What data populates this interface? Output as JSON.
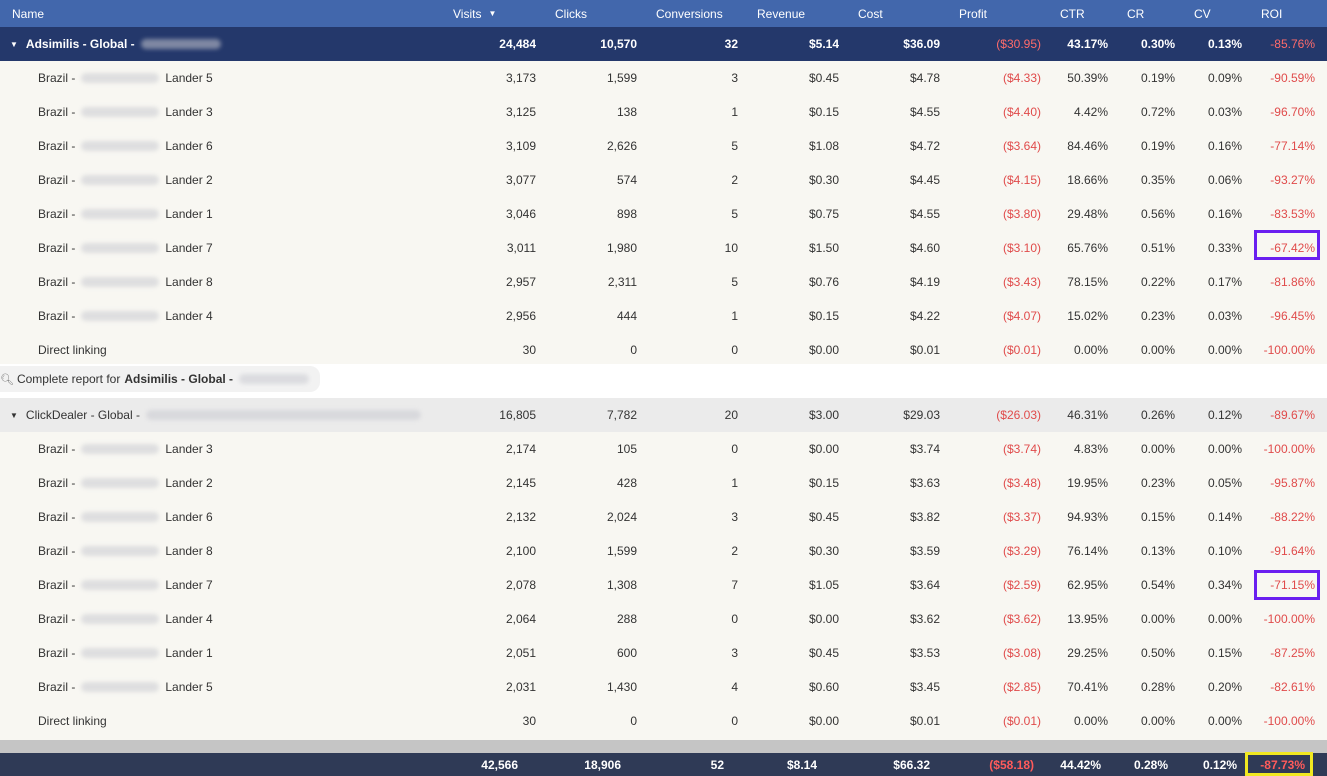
{
  "header": {
    "name": "Name",
    "visits": "Visits",
    "clicks": "Clicks",
    "conversions": "Conversions",
    "revenue": "Revenue",
    "cost": "Cost",
    "profit": "Profit",
    "ctr": "CTR",
    "cr": "CR",
    "cv": "CV",
    "roi": "ROI"
  },
  "groups": [
    {
      "name": "Adsimilis - Global -",
      "totals": {
        "visits": "24,484",
        "clicks": "10,570",
        "conversions": "32",
        "revenue": "$5.14",
        "cost": "$36.09",
        "profit": "($30.95)",
        "ctr": "43.17%",
        "cr": "0.30%",
        "cv": "0.13%",
        "roi": "-85.76%"
      },
      "rows": [
        {
          "prefix": "Brazil -",
          "lander": "Lander 5",
          "visits": "3,173",
          "clicks": "1,599",
          "conversions": "3",
          "revenue": "$0.45",
          "cost": "$4.78",
          "profit": "($4.33)",
          "ctr": "50.39%",
          "cr": "0.19%",
          "cv": "0.09%",
          "roi": "-90.59%"
        },
        {
          "prefix": "Brazil -",
          "lander": "Lander 3",
          "visits": "3,125",
          "clicks": "138",
          "conversions": "1",
          "revenue": "$0.15",
          "cost": "$4.55",
          "profit": "($4.40)",
          "ctr": "4.42%",
          "cr": "0.72%",
          "cv": "0.03%",
          "roi": "-96.70%"
        },
        {
          "prefix": "Brazil -",
          "lander": "Lander 6",
          "visits": "3,109",
          "clicks": "2,626",
          "conversions": "5",
          "revenue": "$1.08",
          "cost": "$4.72",
          "profit": "($3.64)",
          "ctr": "84.46%",
          "cr": "0.19%",
          "cv": "0.16%",
          "roi": "-77.14%"
        },
        {
          "prefix": "Brazil -",
          "lander": "Lander 2",
          "visits": "3,077",
          "clicks": "574",
          "conversions": "2",
          "revenue": "$0.30",
          "cost": "$4.45",
          "profit": "($4.15)",
          "ctr": "18.66%",
          "cr": "0.35%",
          "cv": "0.06%",
          "roi": "-93.27%"
        },
        {
          "prefix": "Brazil -",
          "lander": "Lander 1",
          "visits": "3,046",
          "clicks": "898",
          "conversions": "5",
          "revenue": "$0.75",
          "cost": "$4.55",
          "profit": "($3.80)",
          "ctr": "29.48%",
          "cr": "0.56%",
          "cv": "0.16%",
          "roi": "-83.53%"
        },
        {
          "prefix": "Brazil -",
          "lander": "Lander 7",
          "visits": "3,011",
          "clicks": "1,980",
          "conversions": "10",
          "revenue": "$1.50",
          "cost": "$4.60",
          "profit": "($3.10)",
          "ctr": "65.76%",
          "cr": "0.51%",
          "cv": "0.33%",
          "roi": "-67.42%"
        },
        {
          "prefix": "Brazil -",
          "lander": "Lander 8",
          "visits": "2,957",
          "clicks": "2,311",
          "conversions": "5",
          "revenue": "$0.76",
          "cost": "$4.19",
          "profit": "($3.43)",
          "ctr": "78.15%",
          "cr": "0.22%",
          "cv": "0.17%",
          "roi": "-81.86%"
        },
        {
          "prefix": "Brazil -",
          "lander": "Lander 4",
          "visits": "2,956",
          "clicks": "444",
          "conversions": "1",
          "revenue": "$0.15",
          "cost": "$4.22",
          "profit": "($4.07)",
          "ctr": "15.02%",
          "cr": "0.23%",
          "cv": "0.03%",
          "roi": "-96.45%"
        },
        {
          "prefix": "Direct linking",
          "lander": "",
          "visits": "30",
          "clicks": "0",
          "conversions": "0",
          "revenue": "$0.00",
          "cost": "$0.01",
          "profit": "($0.01)",
          "ctr": "0.00%",
          "cr": "0.00%",
          "cv": "0.00%",
          "roi": "-100.00%"
        }
      ],
      "complete_report": {
        "prefix": "Complete report for",
        "bold": "Adsimilis - Global -"
      }
    },
    {
      "name": "ClickDealer - Global -",
      "totals": {
        "visits": "16,805",
        "clicks": "7,782",
        "conversions": "20",
        "revenue": "$3.00",
        "cost": "$29.03",
        "profit": "($26.03)",
        "ctr": "46.31%",
        "cr": "0.26%",
        "cv": "0.12%",
        "roi": "-89.67%"
      },
      "rows": [
        {
          "prefix": "Brazil -",
          "lander": "Lander 3",
          "visits": "2,174",
          "clicks": "105",
          "conversions": "0",
          "revenue": "$0.00",
          "cost": "$3.74",
          "profit": "($3.74)",
          "ctr": "4.83%",
          "cr": "0.00%",
          "cv": "0.00%",
          "roi": "-100.00%"
        },
        {
          "prefix": "Brazil -",
          "lander": "Lander 2",
          "visits": "2,145",
          "clicks": "428",
          "conversions": "1",
          "revenue": "$0.15",
          "cost": "$3.63",
          "profit": "($3.48)",
          "ctr": "19.95%",
          "cr": "0.23%",
          "cv": "0.05%",
          "roi": "-95.87%"
        },
        {
          "prefix": "Brazil -",
          "lander": "Lander 6",
          "visits": "2,132",
          "clicks": "2,024",
          "conversions": "3",
          "revenue": "$0.45",
          "cost": "$3.82",
          "profit": "($3.37)",
          "ctr": "94.93%",
          "cr": "0.15%",
          "cv": "0.14%",
          "roi": "-88.22%"
        },
        {
          "prefix": "Brazil -",
          "lander": "Lander 8",
          "visits": "2,100",
          "clicks": "1,599",
          "conversions": "2",
          "revenue": "$0.30",
          "cost": "$3.59",
          "profit": "($3.29)",
          "ctr": "76.14%",
          "cr": "0.13%",
          "cv": "0.10%",
          "roi": "-91.64%"
        },
        {
          "prefix": "Brazil -",
          "lander": "Lander 7",
          "visits": "2,078",
          "clicks": "1,308",
          "conversions": "7",
          "revenue": "$1.05",
          "cost": "$3.64",
          "profit": "($2.59)",
          "ctr": "62.95%",
          "cr": "0.54%",
          "cv": "0.34%",
          "roi": "-71.15%"
        },
        {
          "prefix": "Brazil -",
          "lander": "Lander 4",
          "visits": "2,064",
          "clicks": "288",
          "conversions": "0",
          "revenue": "$0.00",
          "cost": "$3.62",
          "profit": "($3.62)",
          "ctr": "13.95%",
          "cr": "0.00%",
          "cv": "0.00%",
          "roi": "-100.00%"
        },
        {
          "prefix": "Brazil -",
          "lander": "Lander 1",
          "visits": "2,051",
          "clicks": "600",
          "conversions": "3",
          "revenue": "$0.45",
          "cost": "$3.53",
          "profit": "($3.08)",
          "ctr": "29.25%",
          "cr": "0.50%",
          "cv": "0.15%",
          "roi": "-87.25%"
        },
        {
          "prefix": "Brazil -",
          "lander": "Lander 5",
          "visits": "2,031",
          "clicks": "1,430",
          "conversions": "4",
          "revenue": "$0.60",
          "cost": "$3.45",
          "profit": "($2.85)",
          "ctr": "70.41%",
          "cr": "0.28%",
          "cv": "0.20%",
          "roi": "-82.61%"
        },
        {
          "prefix": "Direct linking",
          "lander": "",
          "visits": "30",
          "clicks": "0",
          "conversions": "0",
          "revenue": "$0.00",
          "cost": "$0.01",
          "profit": "($0.01)",
          "ctr": "0.00%",
          "cr": "0.00%",
          "cv": "0.00%",
          "roi": "-100.00%"
        }
      ]
    }
  ],
  "grand_totals": {
    "visits": "42,566",
    "clicks": "18,906",
    "conversions": "52",
    "revenue": "$8.14",
    "cost": "$66.32",
    "profit": "($58.18)",
    "ctr": "44.42%",
    "cr": "0.28%",
    "cv": "0.12%",
    "roi": "-87.73%"
  },
  "colors": {
    "header": "#4267ac",
    "group_header": "#24386b",
    "negative": "#e04b4b",
    "highlight": "#6a1ff0",
    "totals_highlight": "#f0e821"
  }
}
